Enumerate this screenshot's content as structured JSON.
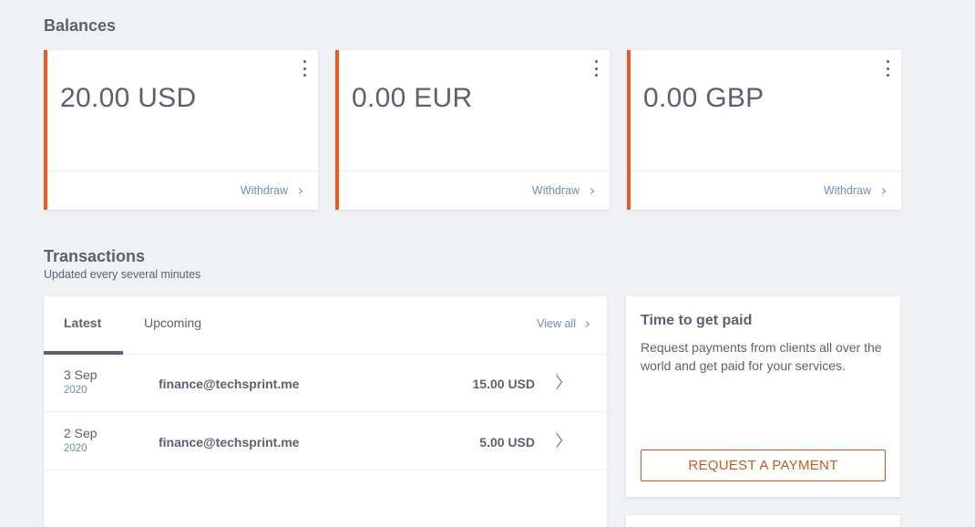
{
  "balances": {
    "title": "Balances",
    "cards": [
      {
        "amount": "20.00 USD",
        "action": "Withdraw"
      },
      {
        "amount": "0.00 EUR",
        "action": "Withdraw"
      },
      {
        "amount": "0.00 GBP",
        "action": "Withdraw"
      }
    ],
    "accent_color": "#ee5a1d"
  },
  "transactions": {
    "title": "Transactions",
    "subtitle": "Updated every several minutes",
    "tabs": [
      {
        "label": "Latest",
        "active": true
      },
      {
        "label": "Upcoming",
        "active": false
      }
    ],
    "view_all": "View all",
    "rows": [
      {
        "day": "3 Sep",
        "year": "2020",
        "email": "finance@techsprint.me",
        "amount": "15.00 USD"
      },
      {
        "day": "2 Sep",
        "year": "2020",
        "email": "finance@techsprint.me",
        "amount": "5.00 USD"
      }
    ]
  },
  "promo": {
    "title": "Time to get paid",
    "text": "Request payments from clients all over the world and get paid for your services.",
    "button": "REQUEST A PAYMENT",
    "button_color": "#d5561d"
  },
  "icons": {
    "menu": "kebab-menu-icon",
    "chevron": "chevron-right-icon"
  }
}
